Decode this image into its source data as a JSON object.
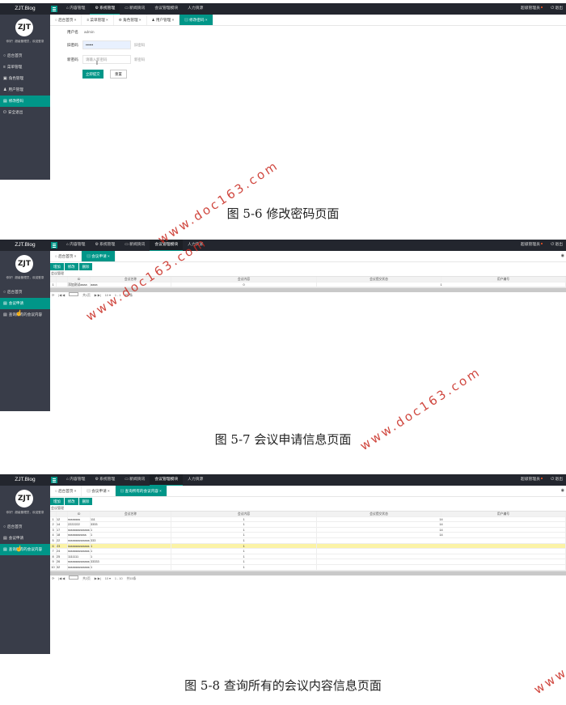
{
  "brand": "ZJT.Blog",
  "topnav": [
    "内容管理",
    "系统管理",
    "新闻资讯",
    "会议管理模块",
    "人力资源"
  ],
  "topright": {
    "user": "超级管理员",
    "logout": "退出"
  },
  "side_caption": "你好！超级管理员，欢迎登录",
  "screens": [
    {
      "active_topnav": 1,
      "side_items": [
        {
          "icon": "home-icon",
          "glyph": "○",
          "label": "后台首页"
        },
        {
          "icon": "menu-icon",
          "glyph": "≡",
          "label": "菜单管理"
        },
        {
          "icon": "role-icon",
          "glyph": "▣",
          "label": "角色管理"
        },
        {
          "icon": "user-icon",
          "glyph": "♟",
          "label": "用户管理"
        },
        {
          "icon": "password-icon",
          "glyph": "▤",
          "label": "修改密码",
          "active": true
        },
        {
          "icon": "logout-icon",
          "glyph": "⏻",
          "label": "安全退出"
        }
      ],
      "tabs": [
        {
          "label": "后台首页",
          "icon": "○"
        },
        {
          "label": "菜单管理",
          "icon": "≡"
        },
        {
          "label": "角色管理",
          "icon": "⚙"
        },
        {
          "label": "用户管理",
          "icon": "♟"
        },
        {
          "label": "修改密码",
          "icon": "▤",
          "active": true
        }
      ],
      "form": {
        "username_label": "用户名",
        "username_value": "admin",
        "old_label": "旧密码",
        "old_value": "••••••",
        "old_hint": "旧密码",
        "new_label": "新密码",
        "new_placeholder": "请输入新密码",
        "new_hint": "新密码",
        "submit": "立即提交",
        "reset": "重置"
      },
      "caption": "图 5-6 修改密码页面"
    },
    {
      "active_topnav": 3,
      "side_items": [
        {
          "icon": "home-icon",
          "glyph": "○",
          "label": "后台首页"
        },
        {
          "icon": "meeting-apply-icon",
          "glyph": "▤",
          "label": "会议申请",
          "active": true
        },
        {
          "icon": "meeting-list-icon",
          "glyph": "▤",
          "label": "查询所有的会议内容"
        }
      ],
      "tabs": [
        {
          "label": "后台首页",
          "icon": "○"
        },
        {
          "label": "会议申请",
          "icon": "▤",
          "active": true
        }
      ],
      "toolbar": [
        "增加",
        "修改",
        "删除"
      ],
      "table_title": "会议管理",
      "columns": [
        "ID",
        "会议名称",
        "会议内容",
        "会议提交状态",
        "用户编号"
      ],
      "rows": [
        [
          "1",
          "",
          "添加测试aaaa",
          "aaaa",
          "0",
          "1"
        ]
      ],
      "pager": {
        "page_of": "共1页",
        "per_page": "10",
        "range": "1 - 1",
        "total": "共1条"
      },
      "caption": "图 5-7 会议申请信息页面"
    },
    {
      "active_topnav": 3,
      "side_items": [
        {
          "icon": "home-icon",
          "glyph": "○",
          "label": "后台首页"
        },
        {
          "icon": "meeting-apply-icon",
          "glyph": "▤",
          "label": "会议申请"
        },
        {
          "icon": "meeting-list-icon",
          "glyph": "▤",
          "label": "查询所有的会议内容",
          "active": true
        }
      ],
      "tabs": [
        {
          "label": "后台首页",
          "icon": "○"
        },
        {
          "label": "会议申请",
          "icon": "▤"
        },
        {
          "label": "查询所有的会议内容",
          "icon": "▤",
          "active": true
        }
      ],
      "toolbar": [
        "增加",
        "修改",
        "删除"
      ],
      "table_title": "会议管理",
      "columns": [
        "ID",
        "会议名称",
        "会议内容",
        "会议提交状态",
        "用户编号"
      ],
      "rows": [
        [
          "1",
          "12",
          "ssssssss",
          "111",
          "1",
          "14"
        ],
        [
          "2",
          "14",
          "2222222",
          "3333",
          "1",
          "14"
        ],
        [
          "3",
          "17",
          "ssssssssssssssss",
          "1",
          "1",
          "14"
        ],
        [
          "4",
          "18",
          "ssssssssssss",
          "1",
          "1",
          "14"
        ],
        [
          "5",
          "22",
          "ssssssssssssssss",
          "333",
          "1",
          ""
        ],
        [
          "6",
          "23",
          "ssssssssssssss",
          "1",
          "1",
          ""
        ],
        [
          "7",
          "24",
          "ssssssssssssss",
          "1",
          "1",
          ""
        ],
        [
          "8",
          "25",
          "1111111",
          "1",
          "1",
          ""
        ],
        [
          "9",
          "26",
          "ssssssssssssssss",
          "33333",
          "1",
          ""
        ],
        [
          "10",
          "32",
          "ssssssssssssssss",
          "1",
          "1",
          ""
        ]
      ],
      "highlight_row": 5,
      "pager": {
        "page_of": "共2页",
        "per_page": "10",
        "range": "1 - 10",
        "total": "共15条"
      },
      "caption": "图 5-8 查询所有的会议内容信息页面"
    }
  ],
  "watermark": "www.doc163.com",
  "colors": {
    "accent": "#009688",
    "topbar": "#23262e",
    "sidebar": "#393d49",
    "highlight": "#fbf3a6",
    "watermark": "#c8281e"
  }
}
